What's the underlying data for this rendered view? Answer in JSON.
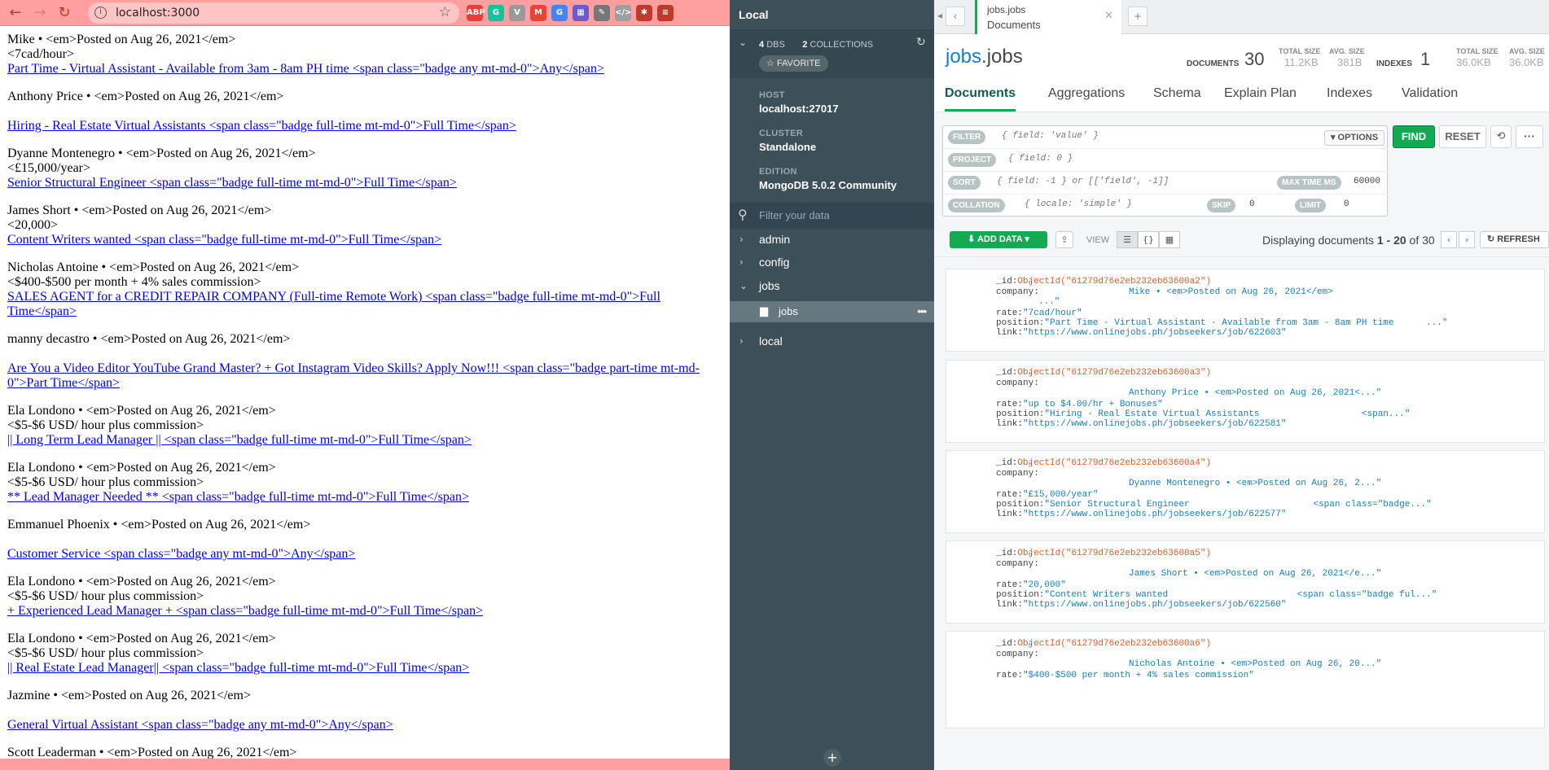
{
  "browser": {
    "url": "localhost:3000",
    "extensions": [
      {
        "name": "adblock-icon",
        "label": "ABP",
        "color": "#e2413a"
      },
      {
        "name": "grammarly-icon",
        "label": "G",
        "color": "#15c39a"
      },
      {
        "name": "v-ext-icon",
        "label": "V",
        "color": "#999999"
      },
      {
        "name": "gmail-icon",
        "label": "M",
        "color": "#ea4335"
      },
      {
        "name": "g-ext-icon",
        "label": "G",
        "color": "#4285f4"
      },
      {
        "name": "tiles-ext-icon",
        "label": "▦",
        "color": "#6a5acd"
      },
      {
        "name": "eyedropper-icon",
        "label": "✎",
        "color": "#777777"
      },
      {
        "name": "devtools-ext-icon",
        "label": "</>",
        "color": "#9e9e9e"
      },
      {
        "name": "puzzle-icon",
        "label": "✱",
        "color": "#c0392b"
      },
      {
        "name": "playlist-icon",
        "label": "≡",
        "color": "#c0392b"
      }
    ]
  },
  "jobs_page": [
    {
      "meta": "Mike • <em>Posted on Aug 26, 2021</em>",
      "rate": "<7cad/hour>",
      "link": "Part Time - Virtual Assistant - Available from 3am - 8am PH time <span class=\"badge any mt-md-0\">Any</span>"
    },
    {
      "meta": "Anthony Price • <em>Posted on Aug 26, 2021</em>",
      "rate": "",
      "link": "Hiring - Real Estate Virtual Assistants <span class=\"badge full-time mt-md-0\">Full Time</span>"
    },
    {
      "meta": "Dyanne Montenegro • <em>Posted on Aug 26, 2021</em>",
      "rate": "<£15,000/year>",
      "link": "Senior Structural Engineer <span class=\"badge full-time mt-md-0\">Full Time</span>"
    },
    {
      "meta": "James Short • <em>Posted on Aug 26, 2021</em>",
      "rate": "<20,000>",
      "link": "Content Writers wanted <span class=\"badge full-time mt-md-0\">Full Time</span>"
    },
    {
      "meta": "Nicholas Antoine • <em>Posted on Aug 26, 2021</em>",
      "rate": "<$400-$500 per month + 4% sales commission>",
      "link": "SALES AGENT for a CREDIT REPAIR COMPANY (Full-time Remote Work) <span class=\"badge full-time mt-md-0\">Full Time</span>"
    },
    {
      "meta": "manny decastro • <em>Posted on Aug 26, 2021</em>",
      "rate": "",
      "link": "Are You a Video Editor YouTube Grand Master? + Got Instagram Video Skills? Apply Now!!! <span class=\"badge part-time mt-md-0\">Part Time</span>"
    },
    {
      "meta": "Ela Londono • <em>Posted on Aug 26, 2021</em>",
      "rate": "<$5-$6 USD/ hour plus commission>",
      "link": "|| Long Term Lead Manager || <span class=\"badge full-time mt-md-0\">Full Time</span>"
    },
    {
      "meta": "Ela Londono • <em>Posted on Aug 26, 2021</em>",
      "rate": "<$5-$6 USD/ hour plus commission>",
      "link": "** Lead Manager Needed ** <span class=\"badge full-time mt-md-0\">Full Time</span>"
    },
    {
      "meta": "Emmanuel Phoenix • <em>Posted on Aug 26, 2021</em>",
      "rate": "",
      "link": "Customer Service <span class=\"badge any mt-md-0\">Any</span>"
    },
    {
      "meta": "Ela Londono • <em>Posted on Aug 26, 2021</em>",
      "rate": "<$5-$6 USD/ hour plus commission>",
      "link": "+ Experienced Lead Manager + <span class=\"badge full-time mt-md-0\">Full Time</span>"
    },
    {
      "meta": "Ela Londono • <em>Posted on Aug 26, 2021</em>",
      "rate": "<$5-$6 USD/ hour plus commission>",
      "link": "|| Real Estate Lead Manager|| <span class=\"badge full-time mt-md-0\">Full Time</span>"
    },
    {
      "meta": "Jazmine • <em>Posted on Aug 26, 2021</em>",
      "rate": "",
      "link": "General Virtual Assistant <span class=\"badge any mt-md-0\">Any</span>"
    },
    {
      "meta": "Scott Leaderman • <em>Posted on Aug 26, 2021</em>",
      "rate": "",
      "link": ""
    }
  ],
  "sidebar": {
    "title": "Local",
    "dbs_count": "4",
    "dbs_label": "DBS",
    "collections_count": "2",
    "collections_label": "COLLECTIONS",
    "favorite_label": "☆ FAVORITE",
    "host_label": "HOST",
    "host_value": "localhost:27017",
    "cluster_label": "CLUSTER",
    "cluster_value": "Standalone",
    "edition_label": "EDITION",
    "edition_value": "MongoDB 5.0.2 Community",
    "filter_placeholder": "Filter your data",
    "databases": [
      "admin",
      "config",
      "jobs",
      "local"
    ],
    "active_collection": "jobs"
  },
  "tab": {
    "ns": "jobs.jobs",
    "sub": "Documents"
  },
  "collection": {
    "db": "jobs",
    "coll": ".jobs",
    "documents_label": "DOCUMENTS",
    "documents_count": "30",
    "total_size_label": "TOTAL SIZE",
    "total_size": "11.2KB",
    "avg_size_label": "AVG. SIZE",
    "avg_size": "381B",
    "indexes_label": "INDEXES",
    "indexes_count": "1",
    "idx_total_size_label": "TOTAL SIZE",
    "idx_total_size": "36.0KB",
    "idx_avg_size_label": "AVG. SIZE",
    "idx_avg_size": "36.0KB"
  },
  "subtabs": [
    "Documents",
    "Aggregations",
    "Schema",
    "Explain Plan",
    "Indexes",
    "Validation"
  ],
  "query": {
    "filter_label": "FILTER",
    "filter_ph": "{ field: 'value' }",
    "options_label": "▾ OPTIONS",
    "project_label": "PROJECT",
    "project_ph": "{ field: 0 }",
    "sort_label": "SORT",
    "sort_ph": "{ field: -1 } or [['field', -1]]",
    "maxtime_label": "MAX TIME MS",
    "maxtime_value": "60000",
    "collation_label": "COLLATION",
    "collation_ph": "{ locale: 'simple' }",
    "skip_label": "SKIP",
    "skip_value": "0",
    "limit_label": "LIMIT",
    "limit_value": "0",
    "find_label": "FIND",
    "reset_label": "RESET",
    "more_label": "···"
  },
  "toolbar": {
    "add_data_label": "⬇ ADD DATA ▾",
    "view_label": "VIEW",
    "displaying_prefix": "Displaying documents ",
    "range": "1 - 20",
    "of_text": " of ",
    "total": "30",
    "refresh_label": "↻ REFRESH"
  },
  "documents": [
    {
      "id": "ObjectId(\"61279d76e2eb232eb63600a2\")",
      "company_pre": "\"",
      "company": "Mike • <em>Posted on Aug 26, 2021</em>",
      "company_tail": "...\"",
      "rate": "\"7cad/hour\"",
      "position": "\"Part Time - Virtual Assistant - Available from 3am - 8am PH time      ...\"",
      "link": "\"https://www.onlinejobs.ph/jobseekers/job/622603\""
    },
    {
      "id": "ObjectId(\"61279d76e2eb232eb63600a3\")",
      "company_pre": "\"",
      "company": "Anthony Price • <em>Posted on Aug 26, 2021<...\"",
      "company_tail": "",
      "rate": "\"up to $4.00/hr + Bonuses\"",
      "position": "\"Hiring - Real Estate Virtual Assistants                   <span...\"",
      "link": "\"https://www.onlinejobs.ph/jobseekers/job/622581\""
    },
    {
      "id": "ObjectId(\"61279d76e2eb232eb63600a4\")",
      "company_pre": "\"",
      "company": "Dyanne Montenegro • <em>Posted on Aug 26, 2...\"",
      "company_tail": "",
      "rate": "\"£15,000/year\"",
      "position": "\"Senior Structural Engineer                       <span class=\"badge...\"",
      "link": "\"https://www.onlinejobs.ph/jobseekers/job/622577\""
    },
    {
      "id": "ObjectId(\"61279d76e2eb232eb63600a5\")",
      "company_pre": "\"",
      "company": "James Short • <em>Posted on Aug 26, 2021</e...\"",
      "company_tail": "",
      "rate": "\"20,000\"",
      "position": "\"Content Writers wanted                        <span class=\"badge ful...\"",
      "link": "\"https://www.onlinejobs.ph/jobseekers/job/622560\""
    },
    {
      "id": "ObjectId(\"61279d76e2eb232eb63600a6\")",
      "company_pre": "\"",
      "company": "Nicholas Antoine • <em>Posted on Aug 26, 20...\"",
      "company_tail": "",
      "rate": "\"$400-$500 per month + 4% sales commission\"",
      "position": "",
      "link": ""
    }
  ],
  "field_keys": {
    "id": "_id:",
    "company": "company:",
    "rate": "rate:",
    "position": "position:",
    "link": "link:"
  }
}
